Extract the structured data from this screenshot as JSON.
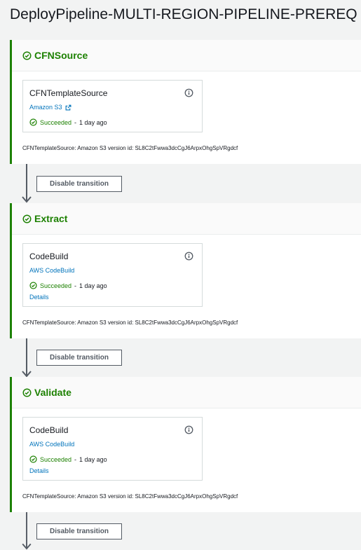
{
  "pipeline": {
    "title": "DeployPipeline-MULTI-REGION-PIPELINE-PREREQ"
  },
  "stages": [
    {
      "name": "CFNSource",
      "action": {
        "name": "CFNTemplateSource",
        "provider": "Amazon S3",
        "status": "Succeeded",
        "separator": "-",
        "time": "1 day ago"
      },
      "revision": "CFNTemplateSource: Amazon S3 version id: SL8C2tFwwa3dcCgJ6ArpxOhgSpVRgdcf"
    },
    {
      "name": "Extract",
      "action": {
        "name": "CodeBuild",
        "provider": "AWS CodeBuild",
        "status": "Succeeded",
        "separator": "-",
        "time": "1 day ago",
        "details": "Details"
      },
      "revision": "CFNTemplateSource: Amazon S3 version id: SL8C2tFwwa3dcCgJ6ArpxOhgSpVRgdcf"
    },
    {
      "name": "Validate",
      "action": {
        "name": "CodeBuild",
        "provider": "AWS CodeBuild",
        "status": "Succeeded",
        "separator": "-",
        "time": "1 day ago",
        "details": "Details"
      },
      "revision": "CFNTemplateSource: Amazon S3 version id: SL8C2tFwwa3dcCgJ6ArpxOhgSpVRgdcf"
    }
  ],
  "transitions": [
    {
      "label": "Disable transition"
    },
    {
      "label": "Disable transition"
    },
    {
      "label": "Disable transition"
    }
  ],
  "colors": {
    "success": "#1d8102",
    "link": "#0073bb",
    "border": "#d5dbdb",
    "background": "#f2f3f3"
  },
  "icons": {
    "status": "check-circle-icon",
    "info": "info-circle-icon",
    "external": "external-link-icon",
    "transition": "arrow-down-icon"
  }
}
